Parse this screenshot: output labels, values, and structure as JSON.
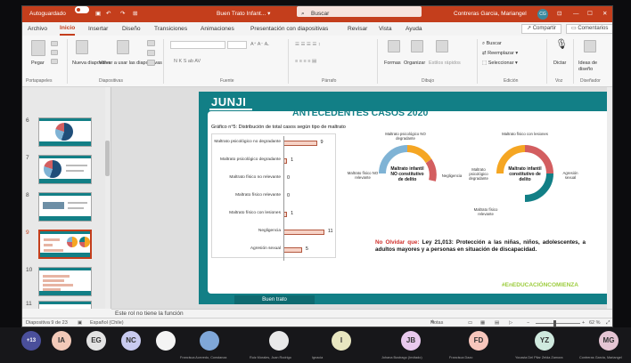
{
  "titlebar": {
    "autosave_label": "Autoguardado",
    "doc_title": "Buen Trato Infant... ▾",
    "search_placeholder": "Buscar",
    "user_name": "Contreras Garcia, Mariangel",
    "user_initials": "CG"
  },
  "menu": {
    "items": [
      "Archivo",
      "Inicio",
      "Insertar",
      "Diseño",
      "Transiciones",
      "Animaciones",
      "Presentación con diapositivas",
      "Revisar",
      "Vista",
      "Ayuda"
    ],
    "active": "Inicio",
    "share_label": "Compartir",
    "comments_label": "Comentarios"
  },
  "ribbon": {
    "paste_label": "Pegar",
    "new_slide_label": "Nueva diapositiva",
    "reuse_label": "Volver a usar las diapositivas",
    "font_buttons": "N  K  S  ab  AV",
    "shapes_label": "Formas",
    "arrange_label": "Organizar",
    "quick_styles_label": "Estilos rápidos",
    "find_label": "Buscar",
    "replace_label": "Reemplazar",
    "select_label": "Seleccionar",
    "dictate_label": "Dictar",
    "design_ideas_label": "Ideas de diseño",
    "groups": [
      "Portapapeles",
      "Diapositivas",
      "Fuente",
      "Párrafo",
      "Dibujo",
      "Edición",
      "Voz",
      "Diseñador"
    ]
  },
  "thumbnails": {
    "numbers": [
      "6",
      "7",
      "8",
      "9",
      "10",
      "11"
    ],
    "selected": "9"
  },
  "slide": {
    "logo": "JUNJI",
    "title": "ANTECEDENTES CASOS 2020",
    "chart_caption": "Gráfico n°5: Distribución de total casos según tipo de maltrato",
    "gauge1": {
      "top": "Maltrato psicológico NO degradante",
      "left": "Maltrato físico NO relevante",
      "right": "Negligencia",
      "center": "Maltrato infantil NO constitutivo de delito"
    },
    "gauge2": {
      "top": "Maltrato físico con lesiones",
      "left": "Maltrato psicológico degradante",
      "right": "Agresión sexual",
      "bottom": "Maltrato físico relevante",
      "center": "Maltrato infantil constitutivo de delito"
    },
    "notice_label": "No Olvidar que:",
    "notice_text": "Ley 21,013: Protección a las niñas, niños, adolescentes, a adultos mayores y a personas en situación de discapacidad.",
    "hashtag": "#EnEDUCACIÓNCOMIENZA",
    "footer_tab": "Buen trato"
  },
  "chart_data": {
    "type": "bar",
    "title": "Gráfico n°5: Distribución de total casos según tipo de maltrato",
    "categories": [
      "Maltrato psicológico no degradante",
      "Maltrato psicológico degradante",
      "Maltrato físico no relevante",
      "Maltrato físico relevante",
      "Maltrato físico con lesiones",
      "Negligencia",
      "Agresión sexual"
    ],
    "values": [
      9,
      1,
      0,
      0,
      1,
      11,
      5
    ],
    "orientation": "horizontal",
    "xlim": [
      0,
      12
    ],
    "grid": false,
    "legend": "none"
  },
  "notes": {
    "text": "Este rol no tiene la función"
  },
  "status": {
    "slide_info": "Diapositiva 9 de 23",
    "language": "Español (Chile)",
    "notes_label": "Notas",
    "zoom": "62 %"
  },
  "meeting": {
    "overflow": "+13",
    "participants": [
      {
        "initials": "IA",
        "name": "",
        "color": "#f2c9b8"
      },
      {
        "initials": "EG",
        "name": "",
        "color": "#e3e3e3"
      },
      {
        "initials": "NC",
        "name": "",
        "color": "#c9cbf0"
      },
      {
        "initials": "",
        "name": "",
        "color": "#f4f4f4"
      },
      {
        "initials": "",
        "name": "Francisca Acevedo, Constanza",
        "color": "#7fa7d8"
      },
      {
        "initials": "",
        "name": "Ruiz Morales, Juan Rodrigo",
        "color": "#e9e9e9"
      },
      {
        "initials": "I",
        "name": "Ignacia",
        "color": "#e8e6c0"
      },
      {
        "initials": "JB",
        "name": "Johana Bustrago (Invitado)",
        "color": "#e9c9ee"
      },
      {
        "initials": "FD",
        "name": "Francisca Dazo",
        "color": "#f7c6bc"
      },
      {
        "initials": "YZ",
        "name": "Yocasta Del Pilar Zelda Zamora",
        "color": "#cfe9de"
      },
      {
        "initials": "MG",
        "name": "Contreras Garcia, Mariangel",
        "color": "#e5c5d3"
      }
    ]
  }
}
